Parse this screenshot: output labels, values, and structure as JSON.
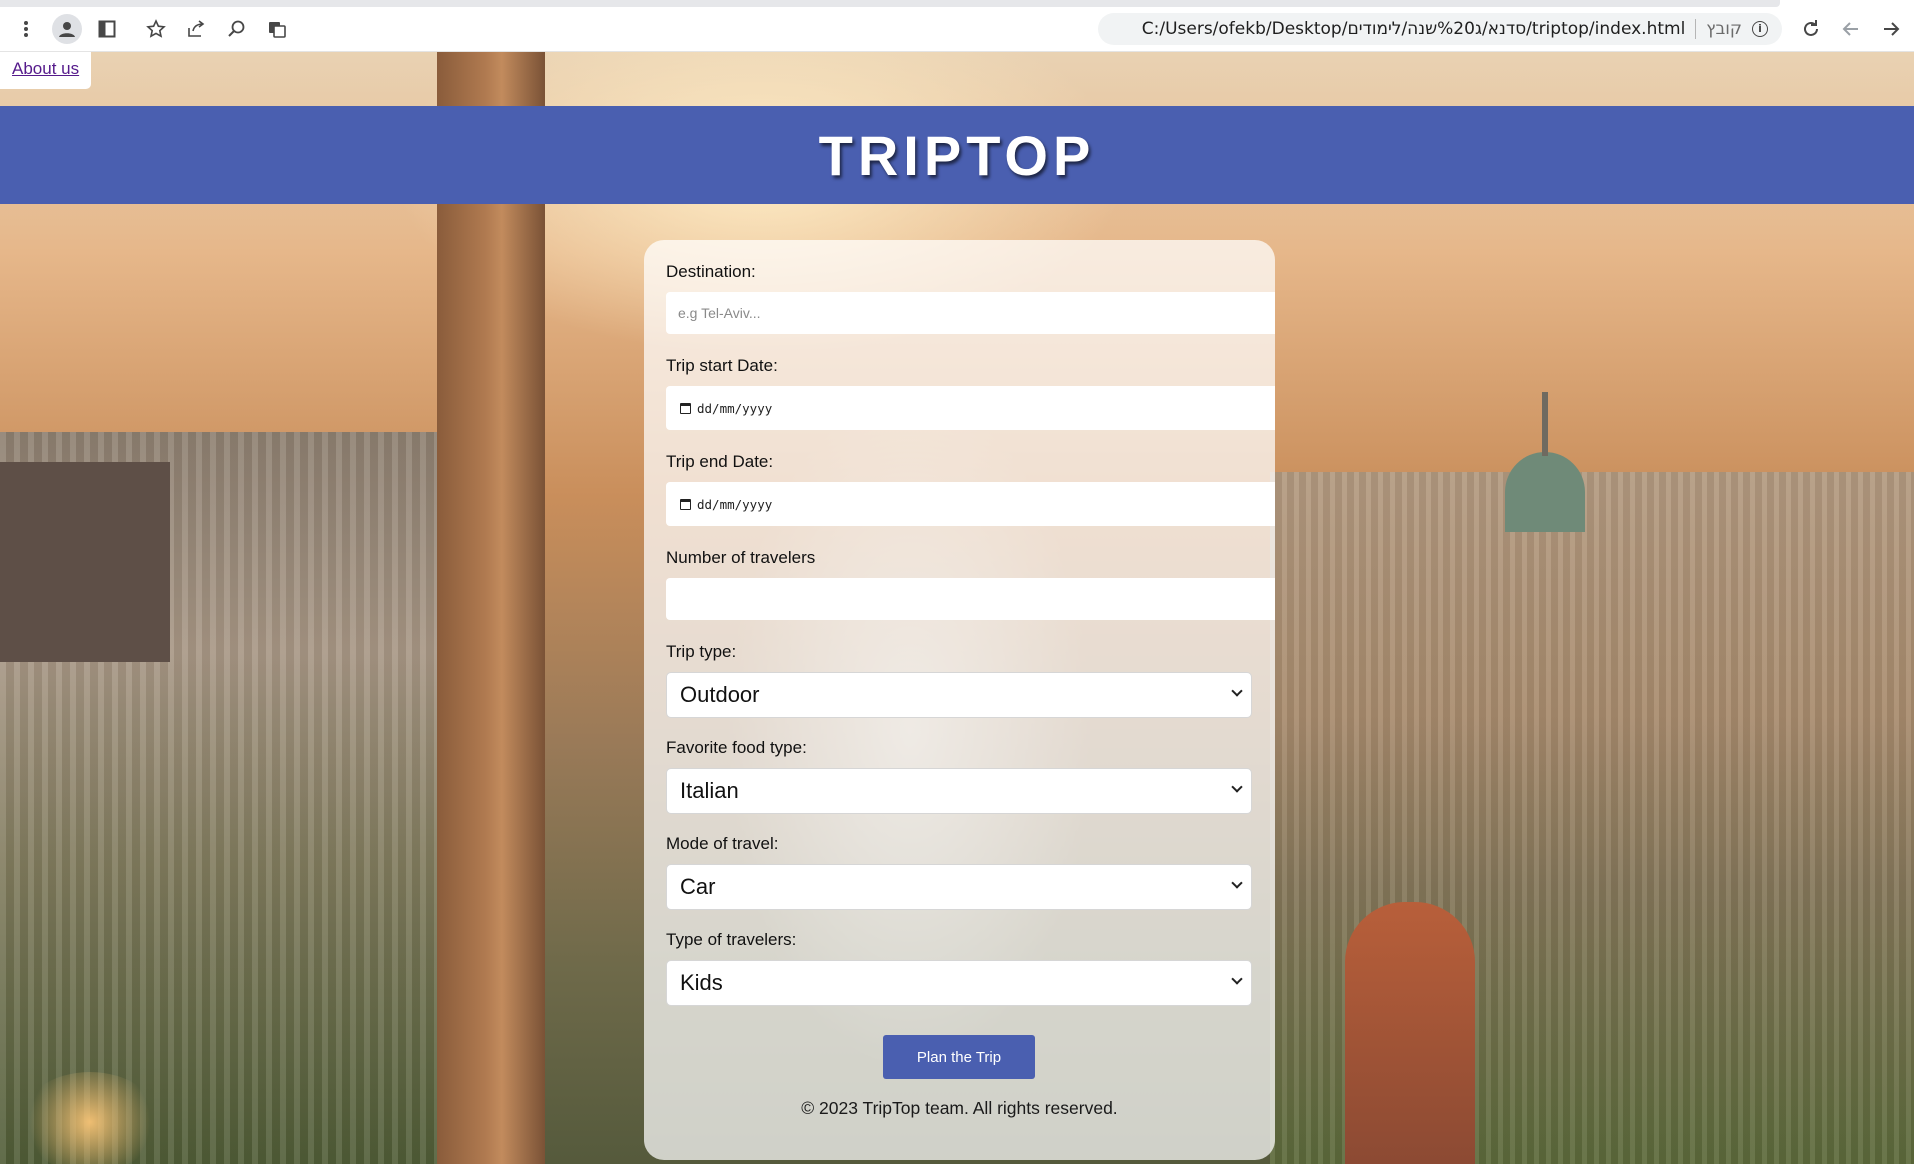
{
  "browser": {
    "url": "C:/Users/ofekb/Desktop/סדנא/ג%20שנה/לימודים/triptop/index.html",
    "scheme_label": "קובץ",
    "toolbar_icons": [
      "menu-dots-icon",
      "profile-icon",
      "side-panel-icon",
      "bookmark-star-icon",
      "share-icon",
      "search-page-icon",
      "translate-icon",
      "info-icon",
      "reload-icon",
      "back-icon",
      "forward-icon"
    ]
  },
  "nav": {
    "about_label": "About us"
  },
  "header": {
    "title": "TRIPTOP"
  },
  "form": {
    "destination": {
      "label": "Destination:",
      "placeholder": "e.g Tel-Aviv..."
    },
    "start_date": {
      "label": "Trip start Date:",
      "placeholder": "dd/mm/yyyy"
    },
    "end_date": {
      "label": "Trip end Date:",
      "placeholder": "dd/mm/yyyy"
    },
    "travelers_count": {
      "label": "Number of travelers",
      "value": ""
    },
    "trip_type": {
      "label": "Trip type:",
      "selected": "Outdoor"
    },
    "food_type": {
      "label": "Favorite food type:",
      "selected": "Italian"
    },
    "travel_mode": {
      "label": "Mode of travel:",
      "selected": "Car"
    },
    "traveler_type": {
      "label": "Type of travelers:",
      "selected": "Kids"
    },
    "submit_label": "Plan the Trip"
  },
  "footer": {
    "text": "© 2023 TripTop team. All rights reserved."
  },
  "colors": {
    "accent": "#4a5fb0",
    "link_visited": "#551a8b"
  }
}
